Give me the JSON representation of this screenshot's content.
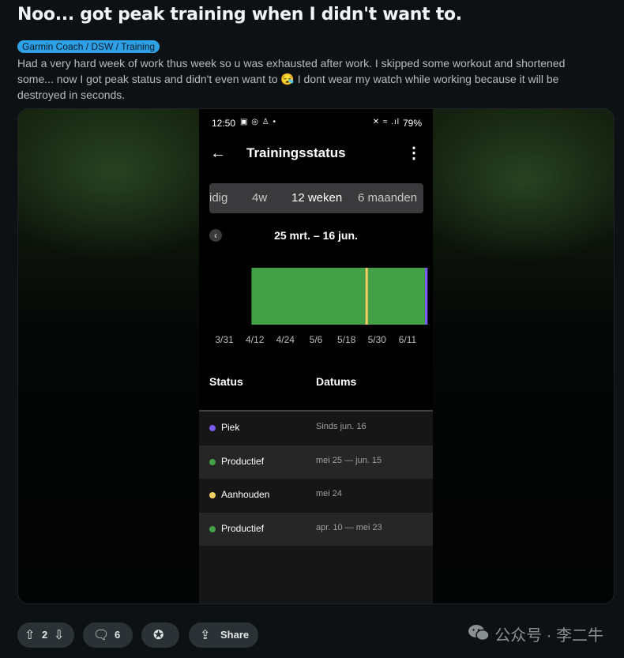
{
  "post": {
    "title": "Noo... got peak training when I didn't want to.",
    "flair": "Garmin Coach / DSW / Training",
    "body": "Had a very hard week of work thus week so u was exhausted after work. I skipped some workout and shortened some... now I got peak status and didn't even want to 😪 I dont wear my watch while working because it will be destroyed in seconds."
  },
  "phone": {
    "status_bar": {
      "time": "12:50",
      "battery": "79%",
      "sys_icons": "▣ ◎ ♙ •",
      "right_icons": "✕ ≈ .ıl"
    },
    "app_bar": {
      "title": "Trainingsstatus",
      "back_icon": "←",
      "more_icon": "⋮"
    },
    "range_tabs": [
      {
        "label": "idig",
        "active": false
      },
      {
        "label": "4w",
        "active": false
      },
      {
        "label": "12 weken",
        "active": true
      },
      {
        "label": "6 maanden",
        "active": false
      }
    ],
    "prev_icon": "‹",
    "date_range": "25 mrt. – 16 jun.",
    "table": {
      "headers": {
        "status": "Status",
        "date": "Datums"
      },
      "rows": [
        {
          "status": "Piek",
          "dates": "Sinds jun. 16",
          "color": "#7b5cf0"
        },
        {
          "status": "Productief",
          "dates": "mei 25 — jun. 15",
          "color": "#43a047"
        },
        {
          "status": "Aanhouden",
          "dates": "mei 24",
          "color": "#f2cf63"
        },
        {
          "status": "Productief",
          "dates": "apr. 10 — mei 23",
          "color": "#43a047"
        }
      ]
    }
  },
  "chart_data": {
    "type": "bar",
    "x_ticks": [
      "3/31",
      "4/12",
      "4/24",
      "5/6",
      "5/18",
      "5/30",
      "6/11"
    ],
    "x_range": [
      "2024-03-25",
      "2024-06-16"
    ],
    "segments": [
      {
        "status": "Productief",
        "start": "2024-04-10",
        "end": "2024-05-23",
        "color": "#43a047"
      },
      {
        "status": "Aanhouden",
        "start": "2024-05-24",
        "end": "2024-05-24",
        "color": "#f2cf63"
      },
      {
        "status": "Productief",
        "start": "2024-05-25",
        "end": "2024-06-15",
        "color": "#43a047"
      },
      {
        "status": "Piek",
        "start": "2024-06-16",
        "end": "2024-06-16",
        "color": "#7b5cf0"
      }
    ]
  },
  "actions": {
    "upvotes": "2",
    "comments": "6",
    "share_label": "Share"
  },
  "watermark": {
    "text": "公众号 · 李二牛"
  }
}
